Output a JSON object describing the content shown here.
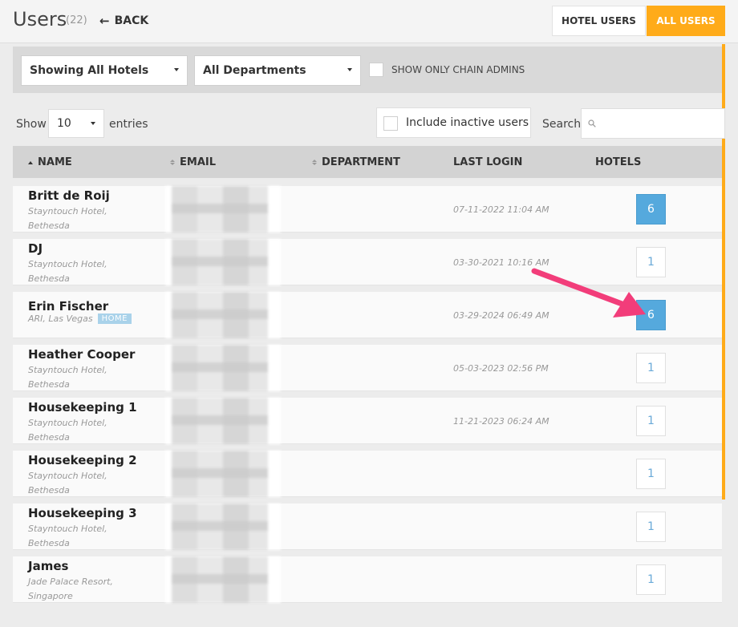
{
  "header": {
    "title": "Users",
    "count": "(22)",
    "back_label": "BACK",
    "tabs": [
      {
        "label": "HOTEL USERS",
        "active": false
      },
      {
        "label": "ALL USERS",
        "active": true
      }
    ]
  },
  "filters": {
    "hotel_select": "Showing All Hotels",
    "department_select": "All Departments",
    "chain_admins_label": "SHOW ONLY CHAIN ADMINS"
  },
  "controls": {
    "show_label": "Show",
    "entries_value": "10",
    "entries_label": "entries",
    "inactive_label": "Include inactive users",
    "search_label": "Search",
    "search_value": ""
  },
  "table": {
    "columns": [
      "NAME",
      "EMAIL",
      "DEPARTMENT",
      "LAST LOGIN",
      "HOTELS"
    ],
    "rows": [
      {
        "name": "Britt de Roij",
        "location": "Stayntouch Hotel, Bethesda",
        "last_login": "07-11-2022 11:04 AM",
        "hotels": "6"
      },
      {
        "name": "DJ",
        "location": "Stayntouch Hotel, Bethesda",
        "last_login": "03-30-2021 10:16 AM",
        "hotels": "1"
      },
      {
        "name": "Erin Fischer",
        "location": "ARI, Las Vegas",
        "badge": "HOME",
        "last_login": "03-29-2024 06:49 AM",
        "hotels": "6"
      },
      {
        "name": "Heather Cooper",
        "location": "Stayntouch Hotel, Bethesda",
        "last_login": "05-03-2023 02:56 PM",
        "hotels": "1"
      },
      {
        "name": "Housekeeping 1",
        "location": "Stayntouch Hotel, Bethesda",
        "last_login": "11-21-2023 06:24 AM",
        "hotels": "1"
      },
      {
        "name": "Housekeeping 2",
        "location": "Stayntouch Hotel, Bethesda",
        "last_login": "",
        "hotels": "1"
      },
      {
        "name": "Housekeeping 3",
        "location": "Stayntouch Hotel, Bethesda",
        "last_login": "",
        "hotels": "1"
      },
      {
        "name": "James",
        "location": "Jade Palace Resort, Singapore",
        "last_login": "",
        "hotels": "1"
      }
    ]
  },
  "colors": {
    "accent": "#ffab19",
    "hotels_multi": "#55a9dd",
    "annotation_arrow": "#f23d7a"
  }
}
